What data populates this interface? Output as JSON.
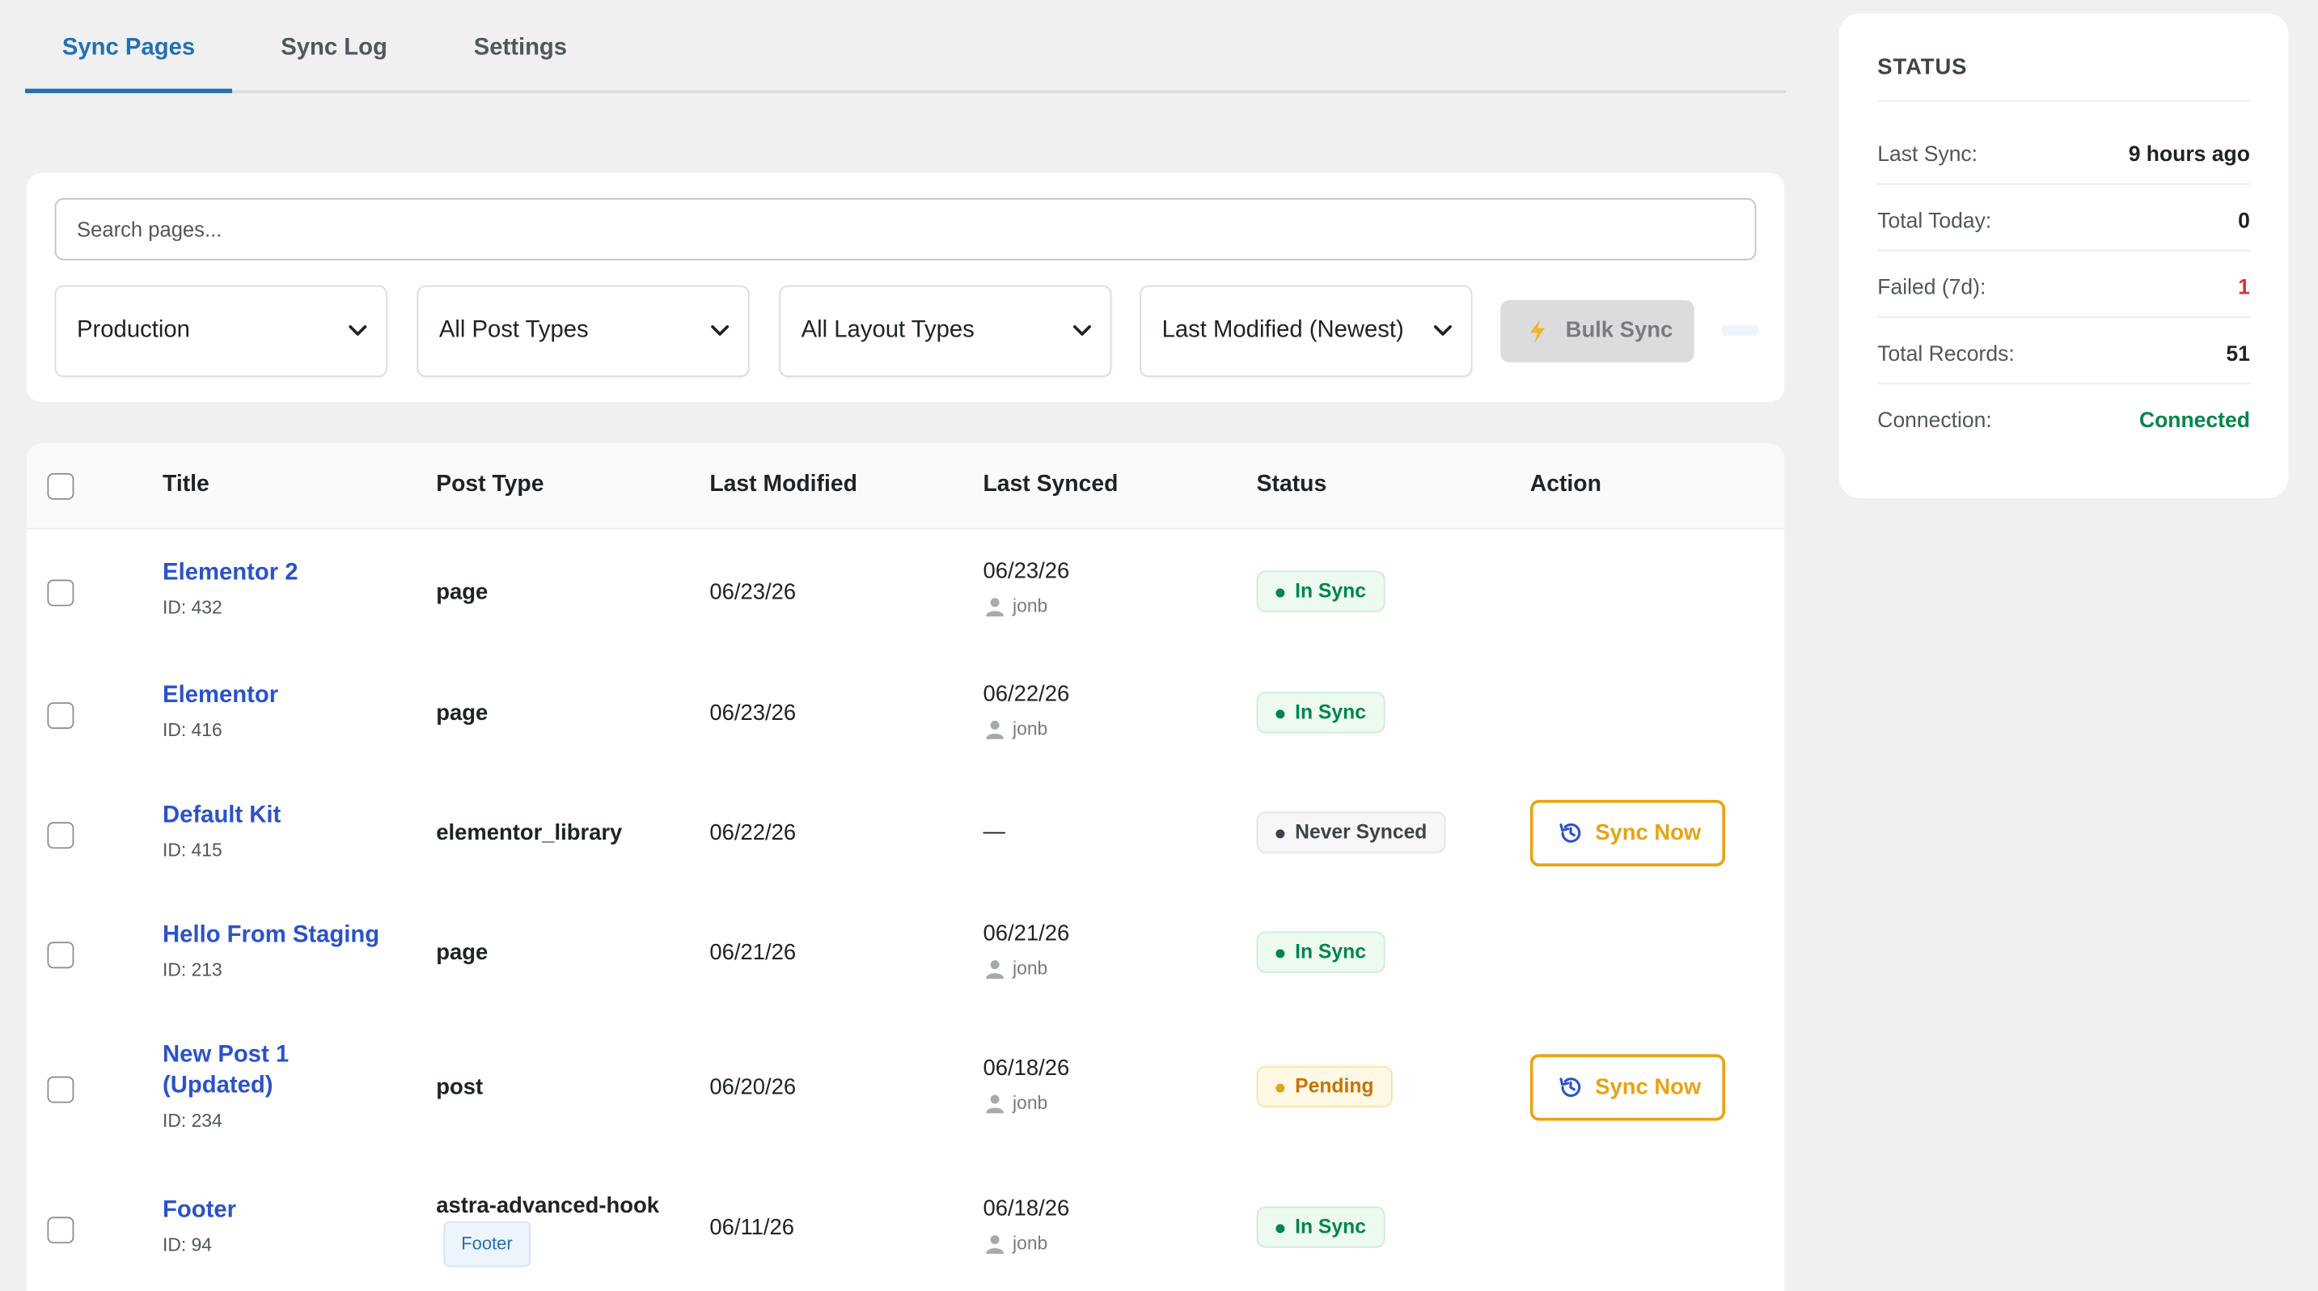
{
  "tabs": [
    {
      "label": "Sync Pages",
      "active": true
    },
    {
      "label": "Sync Log",
      "active": false
    },
    {
      "label": "Settings",
      "active": false
    }
  ],
  "filters": {
    "search_placeholder": "Search pages...",
    "environment": "Production",
    "post_type": "All Post Types",
    "layout_type": "All Layout Types",
    "sort": "Last Modified (Newest)",
    "bulk_label": "Bulk Sync"
  },
  "table": {
    "headers": [
      "Title",
      "Post Type",
      "Last Modified",
      "Last Synced",
      "Status",
      "Action"
    ],
    "rows": [
      {
        "title": "Elementor 2",
        "id": "ID: 432",
        "post_type": "page",
        "last_modified": "06/23/26",
        "last_synced": "06/23/26",
        "user": "jonb",
        "status": "In Sync",
        "action": ""
      },
      {
        "title": "Elementor",
        "id": "ID: 416",
        "post_type": "page",
        "last_modified": "06/23/26",
        "last_synced": "06/22/26",
        "user": "jonb",
        "status": "In Sync",
        "action": ""
      },
      {
        "title": "Default Kit",
        "id": "ID: 415",
        "post_type": "elementor_library",
        "last_modified": "06/22/26",
        "last_synced": "—",
        "user": "",
        "status": "Never Synced",
        "action": "Sync Now"
      },
      {
        "title": "Hello From Staging",
        "id": "ID: 213",
        "post_type": "page",
        "last_modified": "06/21/26",
        "last_synced": "06/21/26",
        "user": "jonb",
        "status": "In Sync",
        "action": ""
      },
      {
        "title_line1": "New Post 1",
        "title_line2": "(Updated)",
        "id": "ID: 234",
        "post_type": "post",
        "last_modified": "06/20/26",
        "last_synced": "06/18/26",
        "user": "jonb",
        "status": "Pending",
        "action": "Sync Now"
      },
      {
        "title": "Footer",
        "id": "ID: 94",
        "post_type": "astra-advanced-hook",
        "tag": "Footer",
        "last_modified": "06/11/26",
        "last_synced": "06/18/26",
        "user": "jonb",
        "status": "In Sync",
        "action": ""
      }
    ]
  },
  "status_panel": {
    "title": "STATUS",
    "items": [
      {
        "label": "Last Sync:",
        "value": "9 hours ago"
      },
      {
        "label": "Total Today:",
        "value": "0"
      },
      {
        "label": "Failed (7d):",
        "value": "1"
      },
      {
        "label": "Total Records:",
        "value": "51"
      },
      {
        "label": "Connection:",
        "value": "Connected"
      }
    ]
  },
  "colors": {
    "accent": "#2271b1",
    "link": "#2b53c9",
    "in_sync": "#00854a",
    "pending": "#c77400",
    "sync_button": "#e8a312",
    "failed": "#d63638"
  }
}
